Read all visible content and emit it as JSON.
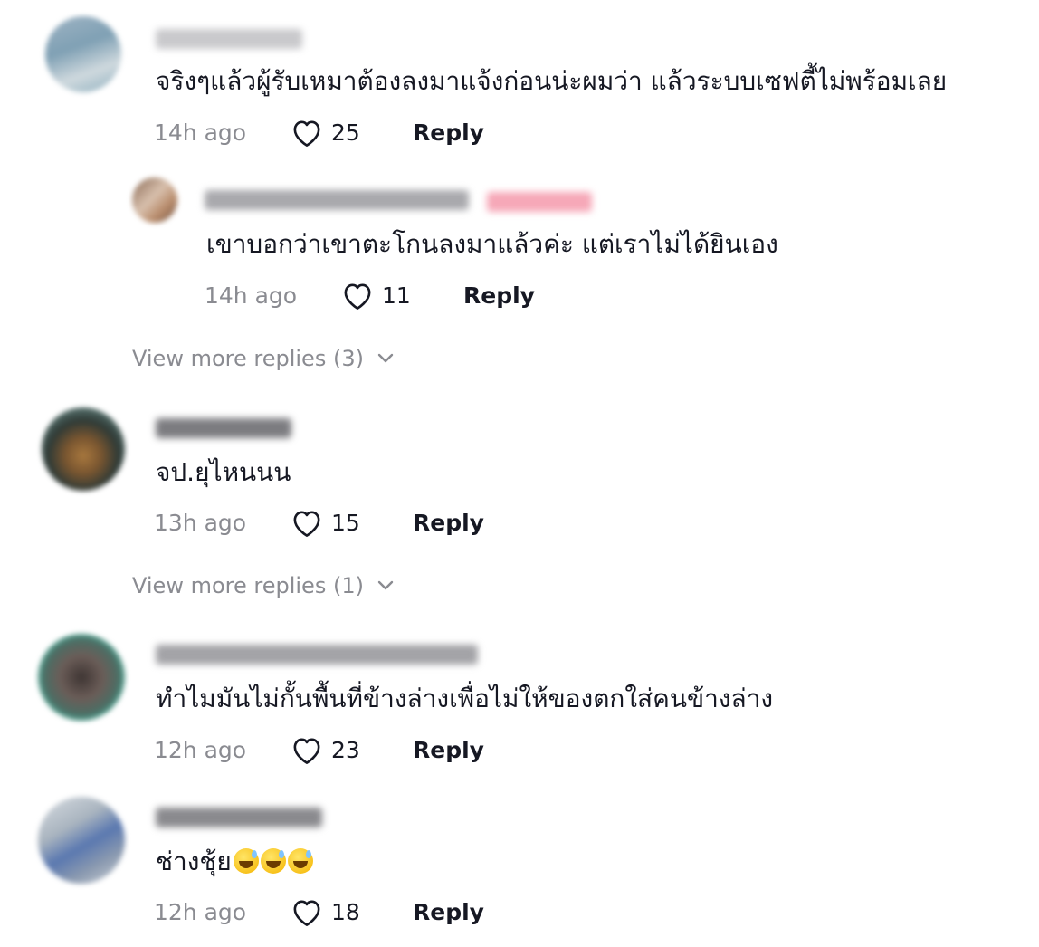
{
  "comments": [
    {
      "text": "จริงๆแล้วผู้รับเหมาต้องลงมาแจ้งก่อนน่ะผมว่า แล้วระบบเซฟตี้ไม่พร้อมเลย",
      "time": "14h ago",
      "likes": "25",
      "reply_label": "Reply",
      "replies": [
        {
          "text": "เขาบอกว่าเขาตะโกนลงมาแล้วค่ะ แต่เราไม่ได้ยินเอง",
          "time": "14h ago",
          "likes": "11",
          "reply_label": "Reply"
        }
      ],
      "view_more": "View more replies (3)"
    },
    {
      "text": "จป.ยุไหนนน",
      "time": "13h ago",
      "likes": "15",
      "reply_label": "Reply",
      "view_more": "View more replies (1)"
    },
    {
      "text": "ทำไมมันไม่กั้นพื้นที่ข้างล่างเพื่อไม่ให้ของตกใส่คนข้างล่าง",
      "time": "12h ago",
      "likes": "23",
      "reply_label": "Reply"
    },
    {
      "text": "ช่างชุ้ย",
      "emoji": "grinning-sweat-emoji x3",
      "time": "12h ago",
      "likes": "18",
      "reply_label": "Reply"
    }
  ],
  "icons": {
    "like": "heart-outline-icon",
    "expand": "chevron-down-icon"
  },
  "colors": {
    "text": "#161823",
    "muted": "#8a8b91",
    "creator_tag": "#fe2c55"
  }
}
